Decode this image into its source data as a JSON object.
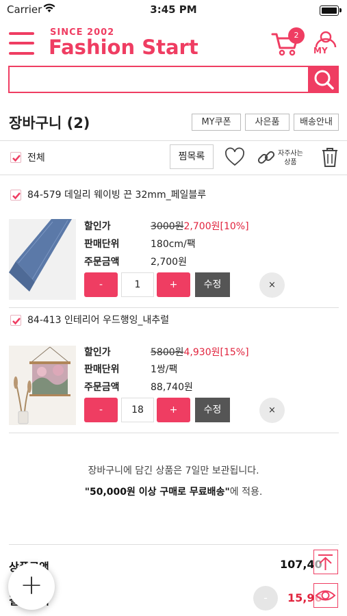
{
  "status_bar": {
    "carrier": "Carrier",
    "time": "3:45 PM"
  },
  "header": {
    "brand_since": "SINCE 2002",
    "brand_name": "Fashion Start",
    "cart_count": "2",
    "my_label": "MY"
  },
  "search": {
    "value": "",
    "placeholder": ""
  },
  "cart": {
    "title": "장바구니 (2)",
    "buttons": {
      "coupon": "MY쿠폰",
      "gift": "사은품",
      "shipping": "배송안내"
    },
    "select_all": "전체",
    "wishlist_btn": "찜목록",
    "frequent_label_1": "자주사는",
    "frequent_label_2": "상품"
  },
  "labels": {
    "sale_price": "할인가",
    "sale_unit": "판매단위",
    "order_amount": "주문금액"
  },
  "items": [
    {
      "name": "84-579 데일리 웨이빙 끈 32mm_페일블루",
      "original_price": "3000원",
      "sale_price": "2,700원",
      "discount": "[10%]",
      "unit": "180cm/팩",
      "amount": "2,700원",
      "qty": "1",
      "minus": "-",
      "plus": "+",
      "edit": "수정",
      "delete": "×"
    },
    {
      "name": "84-413 인테리어 우드행잉_내추럴",
      "original_price": "5800원",
      "sale_price": "4,930원",
      "discount": "[15%]",
      "unit": "1쌍/팩",
      "amount": "88,740원",
      "qty": "18",
      "minus": "-",
      "plus": "+",
      "edit": "수정",
      "delete": "×"
    }
  ],
  "notice": {
    "line1": "장바구니에 담긴 상품은 7일만 보관됩니다.",
    "line2_bold": "\"50,000원 이상 구매로 무료배송\"",
    "line2_rest": "에 적용."
  },
  "summary": {
    "products_label": "상품금액",
    "products_value": "107,40",
    "total_label": "결제금액",
    "total_value": "15,96",
    "minus": "-"
  },
  "fab": {
    "icon": "+"
  },
  "colors": {
    "accent": "#ef3d62",
    "price_red": "#e1233d",
    "edit_gray": "#555555"
  }
}
